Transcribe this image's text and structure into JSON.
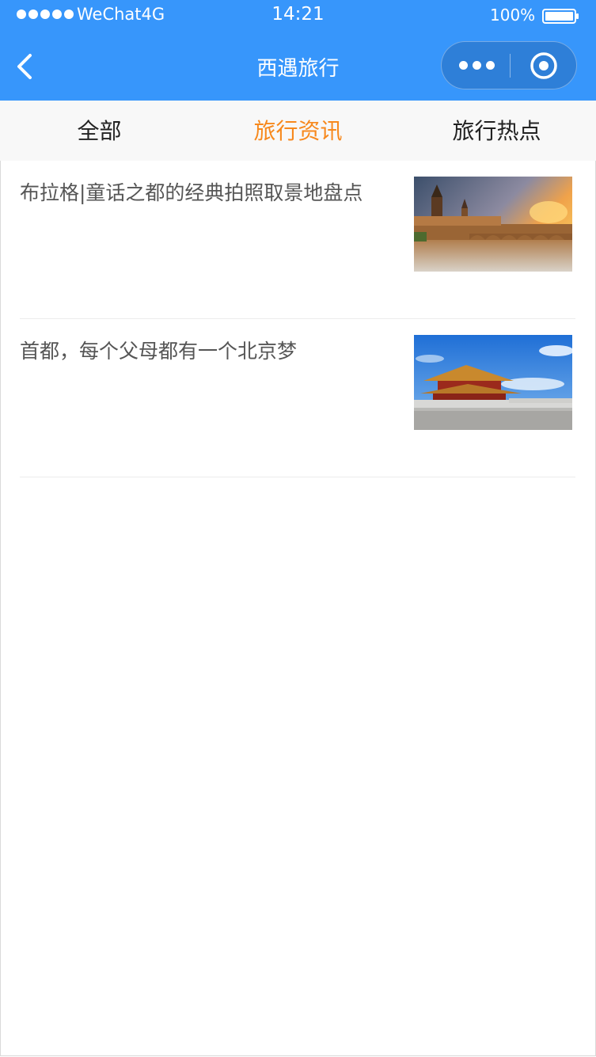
{
  "status_bar": {
    "carrier": "WeChat4G",
    "time": "14:21",
    "battery": "100%"
  },
  "nav": {
    "title": "西遇旅行",
    "back_icon": "chevron-left-icon",
    "more_icon": "more-dots-icon",
    "close_icon": "target-circle-icon",
    "bar_color": "#3796fb"
  },
  "tabs": [
    {
      "label": "全部",
      "active": false
    },
    {
      "label": "旅行资讯",
      "active": true
    },
    {
      "label": "旅行热点",
      "active": false
    }
  ],
  "accent_color": "#f7891d",
  "articles": [
    {
      "title": "布拉格|童话之都的经典拍照取景地盘点",
      "image": "prague-bridge-sunset-photo"
    },
    {
      "title": "首都，每个父母都有一个北京梦",
      "image": "forbidden-city-palace-photo"
    }
  ]
}
